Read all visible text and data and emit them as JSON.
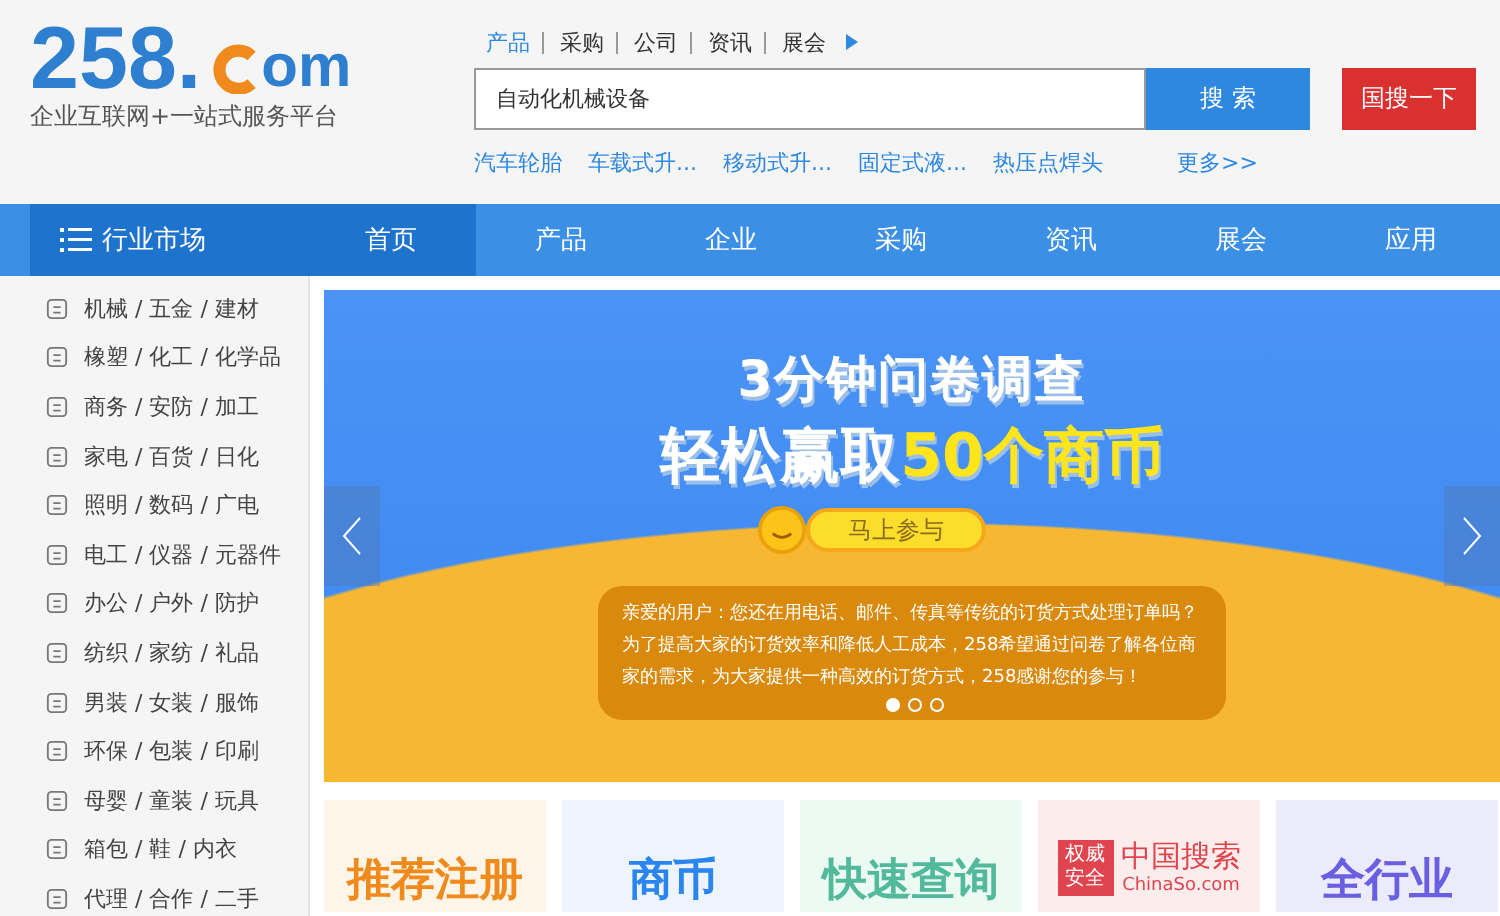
{
  "logo": {
    "number": "258.",
    "suffix": "om",
    "slogan": "企业互联网+一站式服务平台"
  },
  "search_tabs": [
    {
      "label": "产品",
      "selected": true
    },
    {
      "label": "采购",
      "selected": false
    },
    {
      "label": "公司",
      "selected": false
    },
    {
      "label": "资讯",
      "selected": false
    },
    {
      "label": "展会",
      "selected": false
    }
  ],
  "search": {
    "value": "自动化机械设备",
    "button": "搜 索",
    "alt_button": "国搜一下"
  },
  "hot_keywords": [
    "汽车轮胎",
    "车载式升...",
    "移动式升...",
    "固定式液...",
    "热压点焊头"
  ],
  "more_link": "更多>>",
  "nav": {
    "menu_label": "行业市场",
    "items": [
      {
        "label": "首页",
        "selected": true
      },
      {
        "label": "产品",
        "selected": false
      },
      {
        "label": "企业",
        "selected": false
      },
      {
        "label": "采购",
        "selected": false
      },
      {
        "label": "资讯",
        "selected": false
      },
      {
        "label": "展会",
        "selected": false
      },
      {
        "label": "应用",
        "selected": false
      }
    ]
  },
  "categories": [
    "机械 / 五金 / 建材",
    "橡塑 / 化工 / 化学品",
    "商务 / 安防 / 加工",
    "家电 / 百货 / 日化",
    "照明 / 数码 / 广电",
    "电工 / 仪器 / 元器件",
    "办公 / 户外 / 防护",
    "纺织 / 家纺 / 礼品",
    "男装 / 女装 / 服饰",
    "环保 / 包装 / 印刷",
    "母婴 / 童装 / 玩具",
    "箱包 / 鞋 / 内衣",
    "代理 / 合作 / 二手"
  ],
  "banner": {
    "headline": "3分钟问卷调查",
    "subline_white": "轻松赢取",
    "subline_highlight": "50个商币",
    "cta": "马上参与",
    "message": "亲爱的用户：您还在用电话、邮件、传真等传统的订货方式处理订单吗？为了提高大家的订货效率和降低人工成本，258希望通过问卷了解各位商家的需求，为大家提供一种高效的订货方式，258感谢您的参与！",
    "dots": [
      {
        "selected": true
      },
      {
        "selected": false
      },
      {
        "selected": false
      }
    ]
  },
  "tiles": [
    {
      "kind": "plain",
      "title": "推荐注册",
      "color": "#f08a1c"
    },
    {
      "kind": "plain",
      "title": "商币",
      "color": "#2a86ee"
    },
    {
      "kind": "plain",
      "title": "快速查询",
      "color": "#52b99a"
    },
    {
      "kind": "chinaso",
      "badge": "权威安全",
      "title": "中国搜索",
      "subtitle": "ChinaSo.com",
      "color": "#e0454f"
    },
    {
      "kind": "plain",
      "title": "全行业",
      "color": "#6a5fe0"
    }
  ]
}
